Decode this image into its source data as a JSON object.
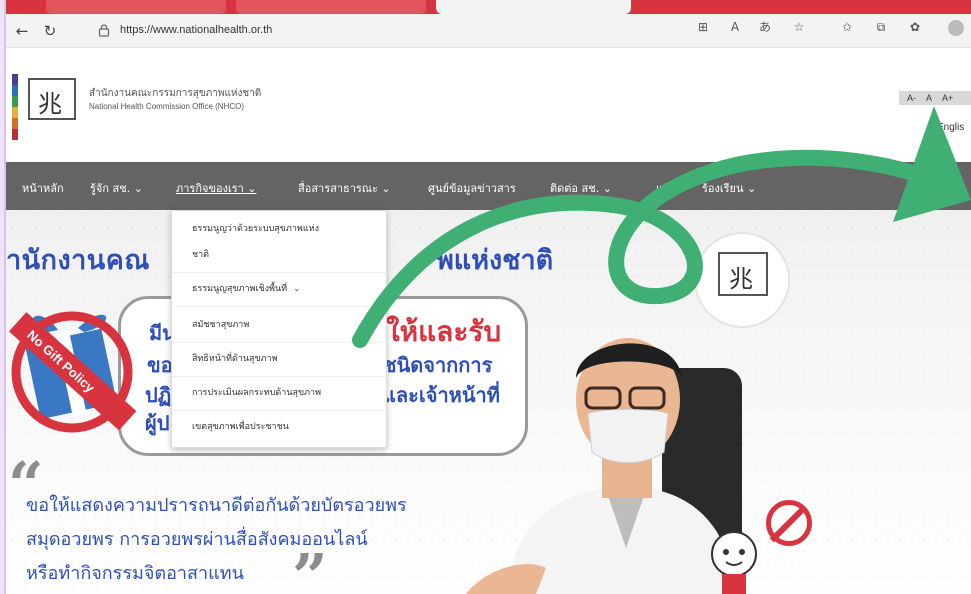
{
  "browser": {
    "url": "https://www.nationalhealth.or.th",
    "toolbar_icons": [
      "split-screen-icon",
      "read-aloud-icon",
      "translate-icon",
      "favorite-star-icon",
      "favorites-icon",
      "collections-icon",
      "extensions-icon",
      "profile-icon"
    ]
  },
  "header": {
    "org_name_th": "สำนักงานคณะกรรมการสุขภาพแห่งชาติ",
    "org_name_en": "National Health Commission Office (NHCO)",
    "font_size_controls": [
      "A-",
      "A",
      "A+"
    ],
    "language": "Englis"
  },
  "nav": {
    "items": [
      {
        "label": "หน้าหลัก",
        "has_dropdown": false
      },
      {
        "label": "รู้จัก สช.",
        "has_dropdown": true
      },
      {
        "label": "ภารกิจของเรา",
        "has_dropdown": true
      },
      {
        "label": "สื่อสารสาธารณะ",
        "has_dropdown": true
      },
      {
        "label": "ศูนย์ข้อมูลข่าวสาร",
        "has_dropdown": false
      },
      {
        "label": "ติดต่อ สช.",
        "has_dropdown": true
      },
      {
        "label": "แจ้ง",
        "has_dropdown": false
      },
      {
        "label": "ร้องเรียน",
        "has_dropdown": true
      }
    ]
  },
  "dropdown": {
    "items": [
      {
        "label": "ธรรมนูญว่าด้วยระบบสุขภาพแห่ง"
      },
      {
        "label": "ชาติ"
      },
      {
        "label": "ธรรมนูญสุขภาพเชิงพื้นที่"
      },
      {
        "label": "สมัชชาสุขภาพ"
      },
      {
        "label": "สิทธิหน้าที่ด้านสุขภาพ"
      },
      {
        "label": "การประเมินผลกระทบด้านสุขภาพ"
      },
      {
        "label": "เขตสุขภาพเพื่อประชาชน"
      }
    ]
  },
  "hero": {
    "title_left": "ำนักงานคณ",
    "title_right": "พแห่งชาติ",
    "policy_badge": "No Gift Policy",
    "policy_lines": [
      "มีน",
      "ขอ",
      "ปฏิ",
      "ผู้ป"
    ],
    "policy_right_lines": [
      "ชนิดจากการ",
      "และเจ้าหน้าที่"
    ],
    "policy_red": "ให้และรับ",
    "body_lines": [
      "ขอให้แสดงความปรารถนาดีต่อกันด้วยบัตรอวยพร",
      "สมุดอวยพร การอวยพรผ่านสื่อสังคมออนไลน์",
      "หรือทำกิจกรรมจิตอาสาแทน"
    ]
  },
  "colors": {
    "nav_bg": "#646464",
    "brand_blue": "#2f4fb8",
    "brand_red": "#d8343f",
    "annotation_green": "#3faf73",
    "tabstrip_red": "#d8343f"
  }
}
